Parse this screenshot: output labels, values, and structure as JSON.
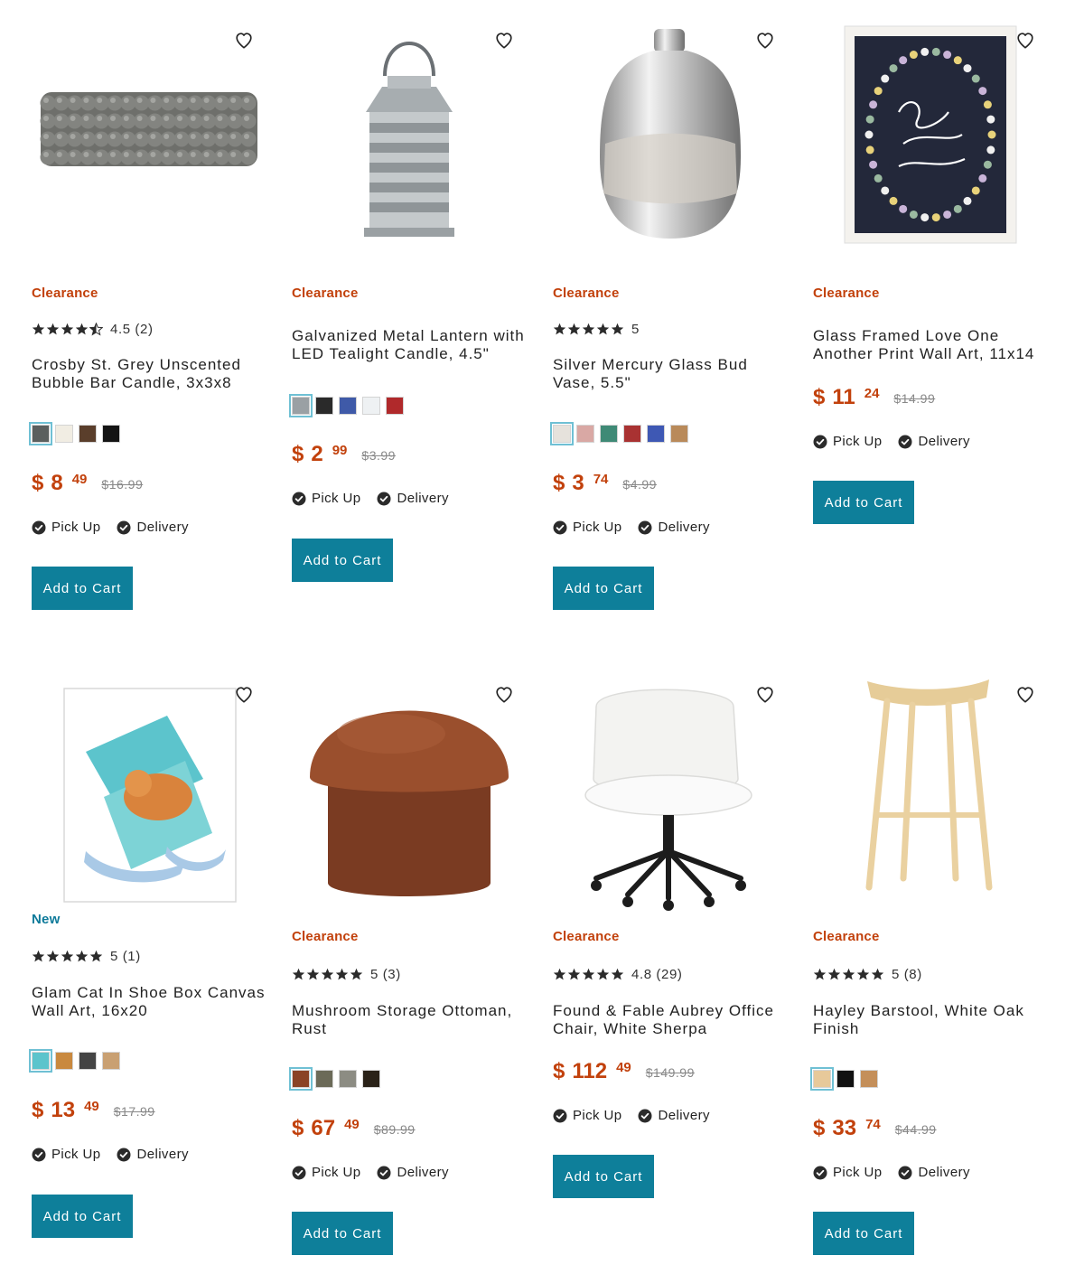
{
  "colors": {
    "accent": "#0e7f9a",
    "clearance": "#c2410c",
    "new": "#0e7a9a"
  },
  "products": [
    {
      "badge": "Clearance",
      "badge_type": "clearance",
      "rating_text": "4.5 (2)",
      "rating": 4.5,
      "title": "Crosby St. Grey Unscented Bubble Bar Candle, 3x3x8",
      "swatches": [
        "#5b5f5e",
        "#f1ede3",
        "#5a3e2b",
        "#141414"
      ],
      "price_dollar": "$",
      "price_whole": "8",
      "price_cents": "49",
      "price_was": "$16.99",
      "pickup": "Pick Up",
      "delivery": "Delivery",
      "cart": "Add to Cart"
    },
    {
      "badge": "Clearance",
      "badge_type": "clearance",
      "rating_text": "",
      "rating": 0,
      "title": "Galvanized Metal Lantern with LED Tealight Candle, 4.5\"",
      "swatches": [
        "#9aa0a4",
        "#2a2a2a",
        "#3f5aa8",
        "#eef1f3",
        "#b0292b"
      ],
      "price_dollar": "$",
      "price_whole": "2",
      "price_cents": "99",
      "price_was": "$3.99",
      "pickup": "Pick Up",
      "delivery": "Delivery",
      "cart": "Add to Cart"
    },
    {
      "badge": "Clearance",
      "badge_type": "clearance",
      "rating_text": "5",
      "rating": 5,
      "title": "Silver Mercury Glass Bud Vase, 5.5\"",
      "swatches": [
        "#e6e2dc",
        "#d9a8a4",
        "#3f8a76",
        "#a93232",
        "#3e58b4",
        "#b98a5a"
      ],
      "price_dollar": "$",
      "price_whole": "3",
      "price_cents": "74",
      "price_was": "$4.99",
      "pickup": "Pick Up",
      "delivery": "Delivery",
      "cart": "Add to Cart"
    },
    {
      "badge": "Clearance",
      "badge_type": "clearance",
      "rating_text": "",
      "rating": 0,
      "title": "Glass Framed Love One Another Print Wall Art, 11x14",
      "swatches": [],
      "price_dollar": "$",
      "price_whole": "11",
      "price_cents": "24",
      "price_was": "$14.99",
      "pickup": "Pick Up",
      "delivery": "Delivery",
      "cart": "Add to Cart"
    },
    {
      "badge": "New",
      "badge_type": "new",
      "rating_text": "5 (1)",
      "rating": 5,
      "title": "Glam Cat In Shoe Box Canvas Wall Art, 16x20",
      "swatches": [
        "#5cc4cc",
        "#c9893f",
        "#444444",
        "#c9a072"
      ],
      "price_dollar": "$",
      "price_whole": "13",
      "price_cents": "49",
      "price_was": "$17.99",
      "pickup": "Pick Up",
      "delivery": "Delivery",
      "cart": "Add to Cart"
    },
    {
      "badge": "Clearance",
      "badge_type": "clearance",
      "rating_text": "5 (3)",
      "rating": 5,
      "title": "Mushroom Storage Ottoman, Rust",
      "swatches": [
        "#8a4326",
        "#6b6a58",
        "#8c8c83",
        "#2a2218"
      ],
      "price_dollar": "$",
      "price_whole": "67",
      "price_cents": "49",
      "price_was": "$89.99",
      "pickup": "Pick Up",
      "delivery": "Delivery",
      "cart": "Add to Cart"
    },
    {
      "badge": "Clearance",
      "badge_type": "clearance",
      "rating_text": "4.8 (29)",
      "rating": 5,
      "title": "Found & Fable Aubrey Office Chair, White Sherpa",
      "swatches": [],
      "price_dollar": "$",
      "price_whole": "112",
      "price_cents": "49",
      "price_was": "$149.99",
      "pickup": "Pick Up",
      "delivery": "Delivery",
      "cart": "Add to Cart"
    },
    {
      "badge": "Clearance",
      "badge_type": "clearance",
      "rating_text": "5 (8)",
      "rating": 5,
      "title": "Hayley Barstool, White Oak Finish",
      "swatches": [
        "#e7c99a",
        "#111111",
        "#c48f5a"
      ],
      "price_dollar": "$",
      "price_whole": "33",
      "price_cents": "74",
      "price_was": "$44.99",
      "pickup": "Pick Up",
      "delivery": "Delivery",
      "cart": "Add to Cart"
    }
  ]
}
